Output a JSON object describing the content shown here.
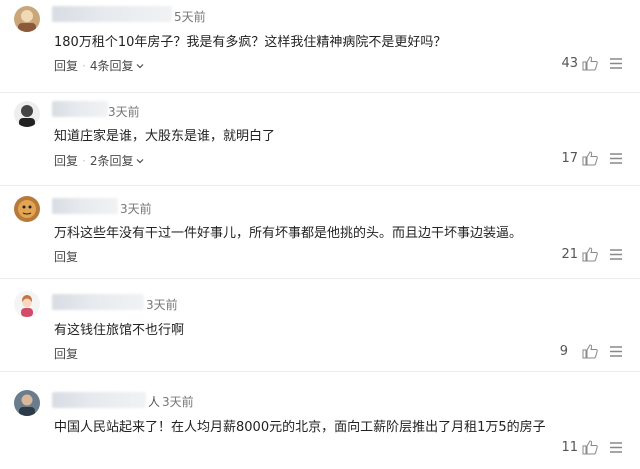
{
  "comments": [
    {
      "name_tail": "",
      "time": "5天前",
      "text": "180万租个10年房子？我是有多疯？这样我住精神病院不是更好吗？",
      "reply_label": "回复",
      "more_replies": "4条回复",
      "likes": "43",
      "avatar_icon": "avatar-icon"
    },
    {
      "name_tail": "",
      "time": "3天前",
      "text": "知道庄家是谁，大股东是谁，就明白了",
      "reply_label": "回复",
      "more_replies": "2条回复",
      "likes": "17",
      "avatar_icon": "avatar-icon"
    },
    {
      "name_tail": "",
      "time": "3天前",
      "text": "万科这些年没有干过一件好事儿，所有坏事都是他挑的头。而且边干坏事边装逼。",
      "reply_label": "回复",
      "more_replies": "",
      "likes": "21",
      "avatar_icon": "avatar-icon"
    },
    {
      "name_tail": "",
      "time": "3天前",
      "text": "有这钱住旅馆不也行啊",
      "reply_label": "回复",
      "more_replies": "",
      "likes": "9",
      "avatar_icon": "avatar-icon"
    },
    {
      "name_tail": "人",
      "time": "3天前",
      "text": "中国人民站起来了！在人均月薪8000元的北京，面向工薪阶层推出了月租1万5的房子",
      "reply_label": "回复",
      "more_replies": "",
      "likes": "11",
      "avatar_icon": "avatar-icon"
    }
  ],
  "colors": {
    "text": "#222222",
    "muted": "#777777",
    "divider": "#ececec"
  }
}
